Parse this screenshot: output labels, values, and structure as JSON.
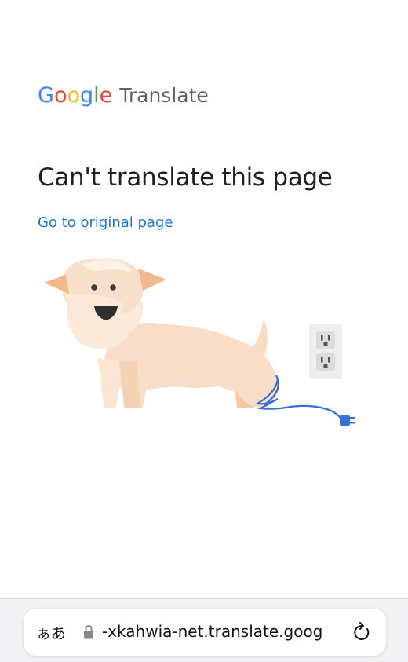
{
  "header": {
    "logo_letters": [
      {
        "char": "G",
        "color": "#4285F4"
      },
      {
        "char": "o",
        "color": "#EA4335"
      },
      {
        "char": "o",
        "color": "#FBBC05"
      },
      {
        "char": "g",
        "color": "#4285F4"
      },
      {
        "char": "l",
        "color": "#34A853"
      },
      {
        "char": "e",
        "color": "#EA4335"
      }
    ],
    "product_name": "Translate"
  },
  "main": {
    "title": "Can't translate this page",
    "link_text": "Go to original page",
    "link_color": "#1a73e8",
    "illustration": {
      "subject": "unplugged-dog-illustration",
      "cord_color": "#3b6fd8"
    }
  },
  "browser_bar": {
    "text_size_label": "ぁあ",
    "url": "-xkahwia-net.translate.goog",
    "lock_icon": "lock-icon",
    "reload_icon": "reload-icon"
  }
}
